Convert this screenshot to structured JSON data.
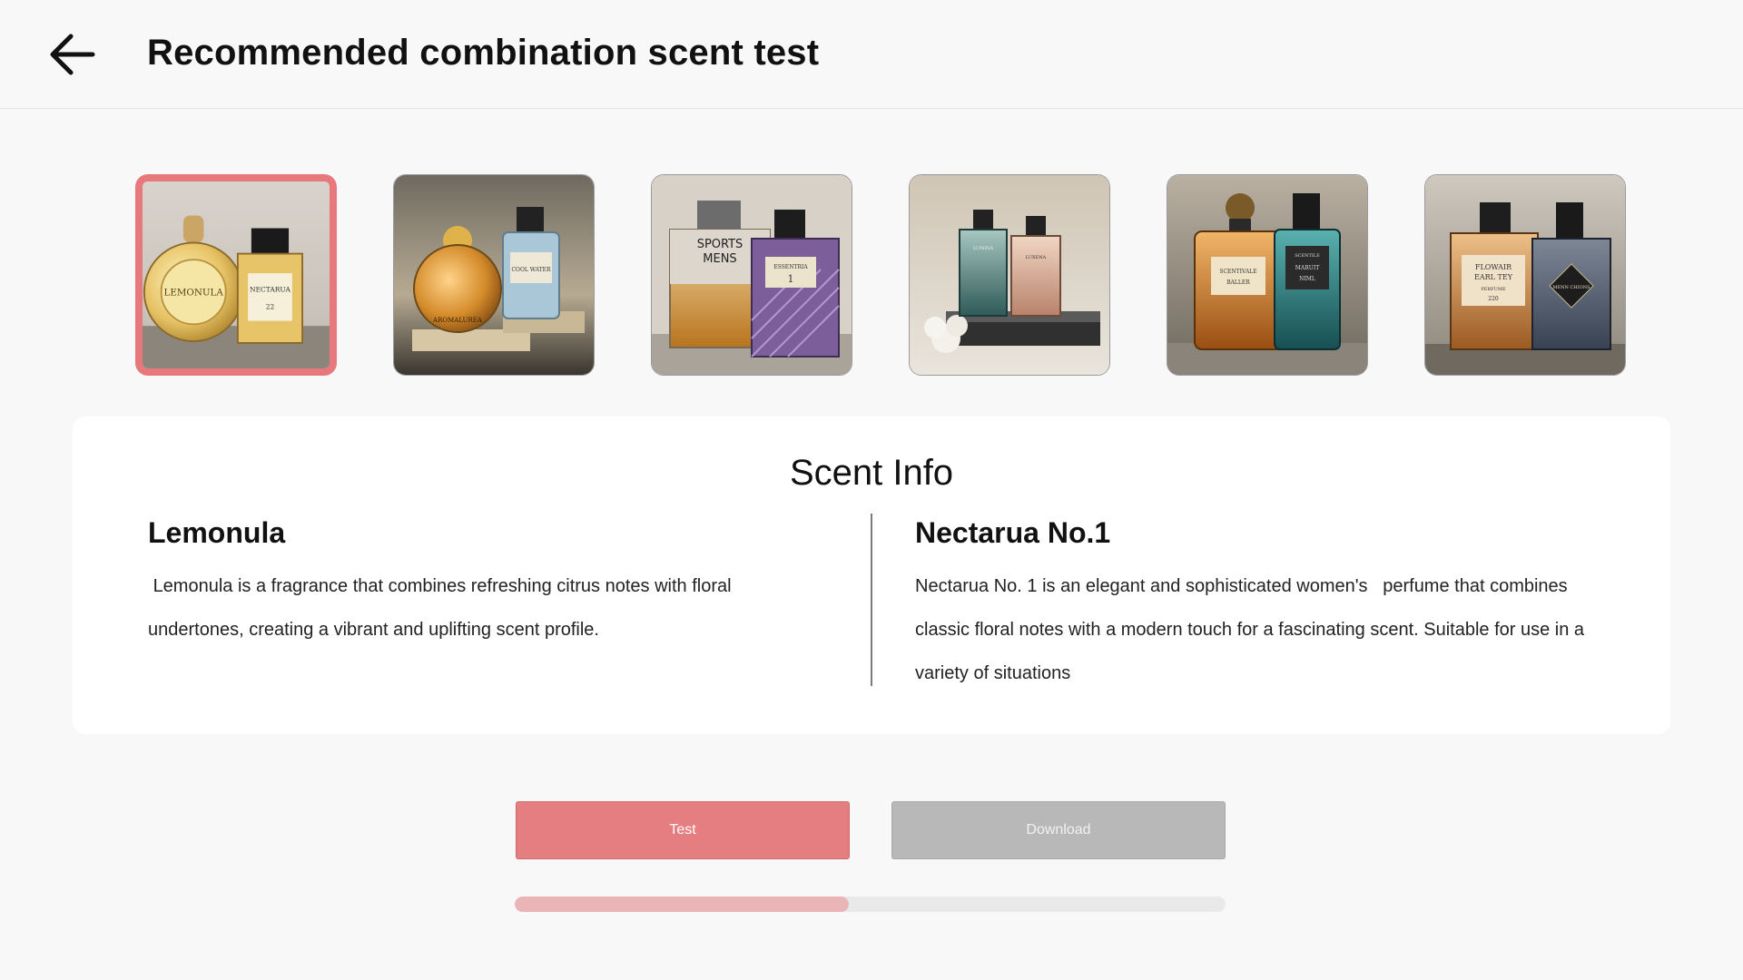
{
  "header": {
    "title": "Recommended combination scent test",
    "back_icon": "arrow-left-icon"
  },
  "thumbnails": [
    {
      "labels": [
        "LEMONULA",
        "NECTARUA",
        "22"
      ],
      "selected": true
    },
    {
      "labels": [
        "AROMALUREA",
        "COOL WATER"
      ],
      "selected": false
    },
    {
      "labels": [
        "SPORTS",
        "MENS",
        "ESSENTRIA",
        "1"
      ],
      "selected": false
    },
    {
      "labels": [
        "LUMINA",
        "LUXENA"
      ],
      "selected": false
    },
    {
      "labels": [
        "SCENTIVALE",
        "BALLER",
        "SCENTILE",
        "MARUIT",
        "NIML"
      ],
      "selected": false
    },
    {
      "labels": [
        "FLOWAIR",
        "EARL TEY",
        "PERFUME",
        "220",
        "MENN CHIONS"
      ],
      "selected": false
    }
  ],
  "scent_info": {
    "title": "Scent Info",
    "left": {
      "name": "Lemonula",
      "description": " Lemonula is a fragrance that combines refreshing citrus notes with floral undertones, creating a vibrant and uplifting scent profile."
    },
    "right": {
      "name": "Nectarua No.1",
      "description": "Nectarua No. 1 is an elegant and sophisticated women's   perfume that combines classic floral notes with a modern touch for a fascinating scent. Suitable for use in a variety of situations"
    }
  },
  "actions": {
    "test_label": "Test",
    "download_label": "Download"
  },
  "progress": {
    "fraction": 0.47
  },
  "colors": {
    "accent": "#e57e80",
    "disabled": "#b8b8b8",
    "progress_fill": "#e9b5b7",
    "progress_track": "#e9e9e9",
    "selected_border": "#e7787c"
  }
}
